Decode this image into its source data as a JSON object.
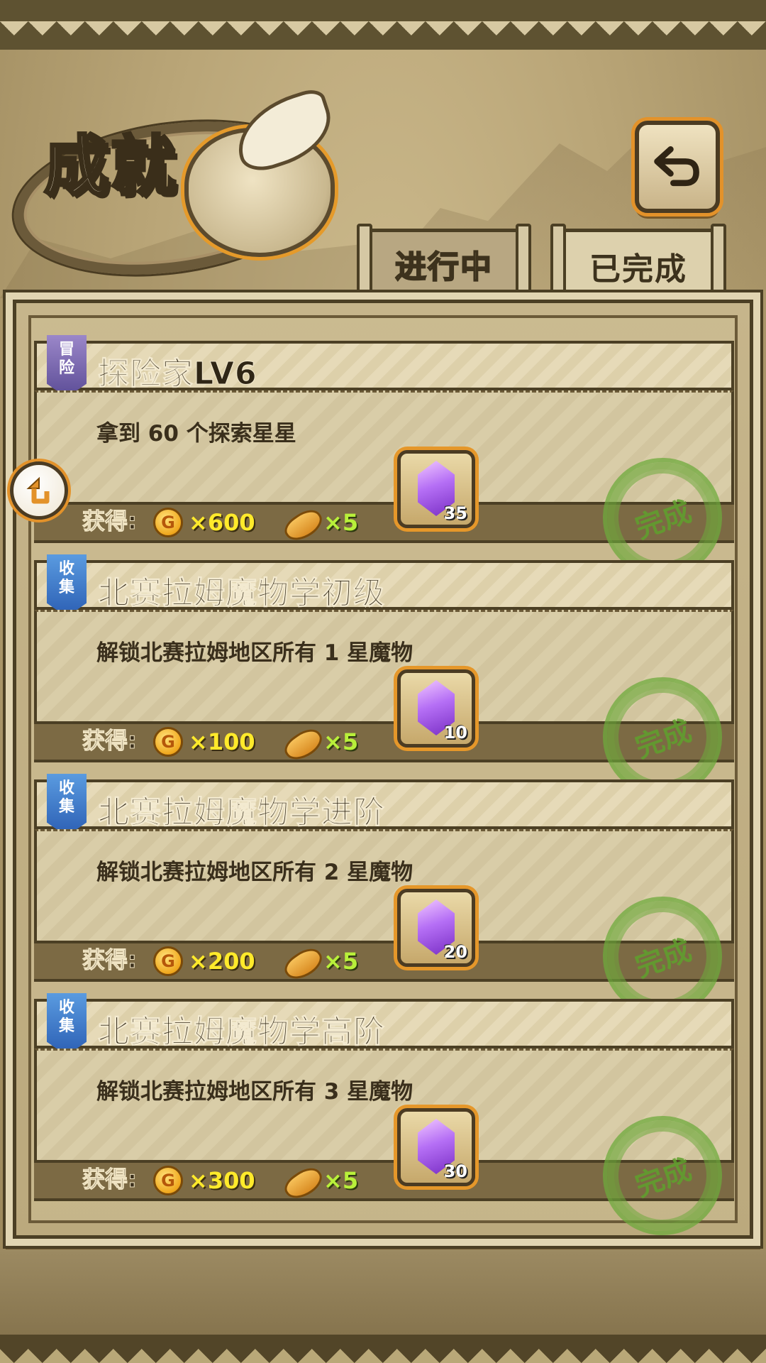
{
  "header": {
    "title": "成就",
    "back_icon": "return-arrow-icon"
  },
  "tabs": [
    {
      "label": "进行中",
      "active": false
    },
    {
      "label": "已完成",
      "active": true
    }
  ],
  "cards": [
    {
      "category": [
        "冒",
        "险"
      ],
      "category_color": "#7a67b4",
      "title": "探险家LV6",
      "desc": "拿到 60 个探索星星",
      "reward_label": "获得:",
      "coin_symbol": "G",
      "coins": "×600",
      "bread": "×5",
      "gems": "35",
      "stamp": "完成"
    },
    {
      "category": [
        "收",
        "集"
      ],
      "category_color": "#3a75c8",
      "title": "北赛拉姆魔物学初级",
      "desc": "解锁北赛拉姆地区所有 1 星魔物",
      "reward_label": "获得:",
      "coin_symbol": "G",
      "coins": "×100",
      "bread": "×5",
      "gems": "10",
      "stamp": "完成"
    },
    {
      "category": [
        "收",
        "集"
      ],
      "category_color": "#3a75c8",
      "title": "北赛拉姆魔物学进阶",
      "desc": "解锁北赛拉姆地区所有 2 星魔物",
      "reward_label": "获得:",
      "coin_symbol": "G",
      "coins": "×200",
      "bread": "×5",
      "gems": "20",
      "stamp": "完成"
    },
    {
      "category": [
        "收",
        "集"
      ],
      "category_color": "#3a75c8",
      "title": "北赛拉姆魔物学高阶",
      "desc": "解锁北赛拉姆地区所有 3 星魔物",
      "reward_label": "获得:",
      "coin_symbol": "G",
      "coins": "×300",
      "bread": "×5",
      "gems": "30",
      "stamp": "完成"
    }
  ]
}
